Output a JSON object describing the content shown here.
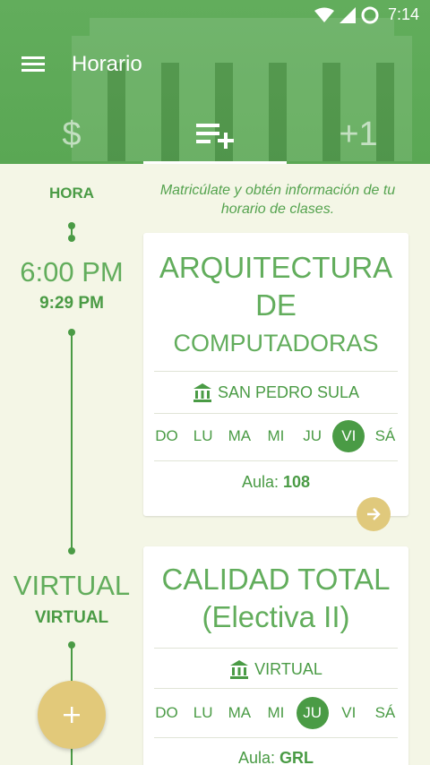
{
  "status": {
    "time": "7:14"
  },
  "app": {
    "title": "Horario"
  },
  "tabs": [
    {
      "label": "$",
      "icon": "dollar-icon"
    },
    {
      "label": "",
      "icon": "playlist-add-icon"
    },
    {
      "label": "+1",
      "icon": "plus-one-icon"
    }
  ],
  "timeline": {
    "header": "HORA"
  },
  "intro": "Matricúlate y obtén información de tu horario de clases.",
  "cards": [
    {
      "time_start": "6:00 PM",
      "time_end": "9:29 PM",
      "title_lines": [
        "ARQUITECTURA",
        "DE",
        "COMPUTADORAS"
      ],
      "campus": "SAN PEDRO SULA",
      "days": [
        "DO",
        "LU",
        "MA",
        "MI",
        "JU",
        "VI",
        "SÁ"
      ],
      "active_day": "VI",
      "aula_label": "Aula:",
      "aula_value": "108"
    },
    {
      "time_start": "VIRTUAL",
      "time_end": "VIRTUAL",
      "title_lines": [
        "CALIDAD TOTAL",
        "(Electiva II)"
      ],
      "campus": "VIRTUAL",
      "days": [
        "DO",
        "LU",
        "MA",
        "MI",
        "JU",
        "VI",
        "SÁ"
      ],
      "active_day": "JU",
      "aula_label": "Aula:",
      "aula_value": "GRL"
    }
  ],
  "colors": {
    "primary": "#62ad5c",
    "dark": "#4a9b45",
    "accent": "#e2c97a",
    "background": "#f4f6e6"
  }
}
